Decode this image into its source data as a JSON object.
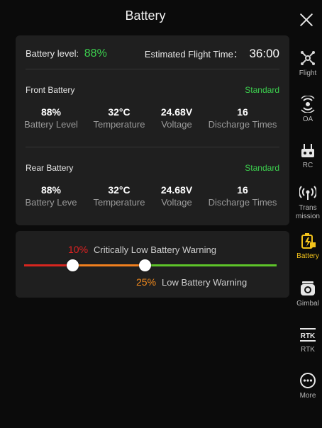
{
  "header": {
    "title": "Battery"
  },
  "summary": {
    "battery_level_label": "Battery level:",
    "battery_level_value": "88%",
    "flight_time_label": "Estimated Flight Time：",
    "flight_time_value": "36:00"
  },
  "front": {
    "title": "Front Battery",
    "status": "Standard",
    "metrics": [
      {
        "value": "88%",
        "label": "Battery Level"
      },
      {
        "value": "32°C",
        "label": "Temperature"
      },
      {
        "value": "24.68V",
        "label": "Voltage"
      },
      {
        "value": "16",
        "label": "Discharge Times"
      }
    ]
  },
  "rear": {
    "title": "Rear Battery",
    "status": "Standard",
    "metrics": [
      {
        "value": "88%",
        "label": "Battery Leve"
      },
      {
        "value": "32°C",
        "label": "Temperature"
      },
      {
        "value": "24.68V",
        "label": "Voltage"
      },
      {
        "value": "16",
        "label": "Discharge Times"
      }
    ]
  },
  "warnings": {
    "critical_pct": "10%",
    "critical_label": "Critically Low Battery Warning",
    "low_pct": "25%",
    "low_label": "Low Battery Warning",
    "critical_value": 10,
    "low_value": 25
  },
  "colors": {
    "accent_green": "#3ccf4e",
    "critical_red": "#e02222",
    "low_orange": "#f28a1d",
    "active_yellow": "#f2c21b"
  },
  "sidebar": {
    "items": [
      {
        "label": "Flight",
        "icon": "drone-icon"
      },
      {
        "label": "OA",
        "icon": "radar-icon"
      },
      {
        "label": "RC",
        "icon": "remote-controller-icon"
      },
      {
        "label": "Trans\nmission",
        "icon": "signal-icon"
      },
      {
        "label": "Battery",
        "icon": "battery-icon",
        "active": true
      },
      {
        "label": "Gimbal",
        "icon": "camera-icon"
      },
      {
        "label": "RTK",
        "icon": "rtk-icon"
      },
      {
        "label": "More",
        "icon": "more-icon"
      }
    ]
  }
}
